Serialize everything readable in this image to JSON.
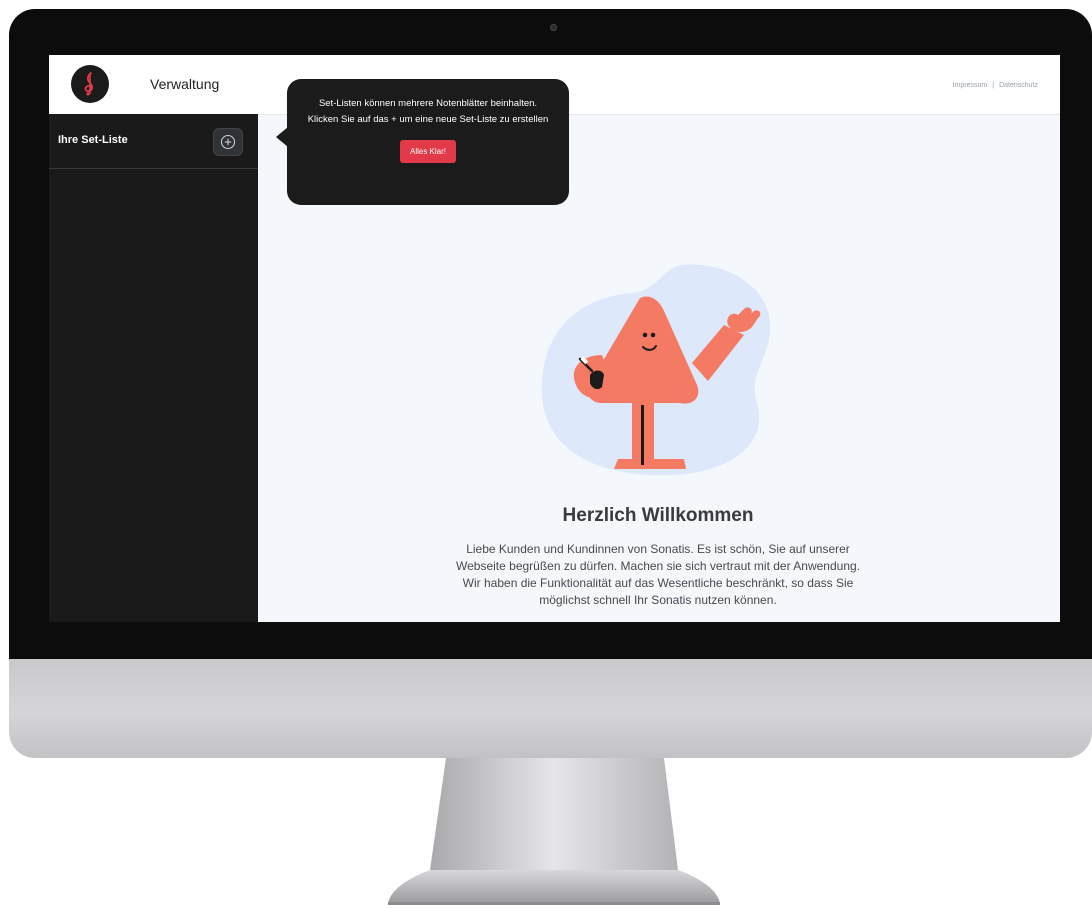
{
  "header": {
    "app_title": "Verwaltung",
    "links": [
      "Impressum",
      "Datenschutz"
    ],
    "separator": "|"
  },
  "sidebar": {
    "title": "Ihre Set-Liste",
    "add_icon": "plus-circle-icon"
  },
  "tooltip": {
    "text": "Set-Listen können mehrere Notenblätter beinhalten. Klicken Sie auf das + um eine neue Set-Liste zu erstellen",
    "button_label": "Alles Klar!"
  },
  "main": {
    "welcome_title": "Herzlich Willkommen",
    "welcome_text": "Liebe Kunden und Kundinnen von Sonatis. Es ist schön, Sie auf unserer Webseite begrüßen zu dürfen. Machen sie sich vertraut mit der Anwendung. Wir haben die Funktionalität auf das Wesentliche beschränkt, so dass Sie möglichst schnell Ihr Sonatis nutzen können."
  },
  "colors": {
    "accent": "#e23a48",
    "sidebar_bg": "#1a1a1a",
    "content_bg": "#f4f7fb",
    "character": "#f47a63",
    "blob": "#dde8fb"
  },
  "icons": [
    "treble-clef-icon",
    "plus-circle-icon"
  ]
}
